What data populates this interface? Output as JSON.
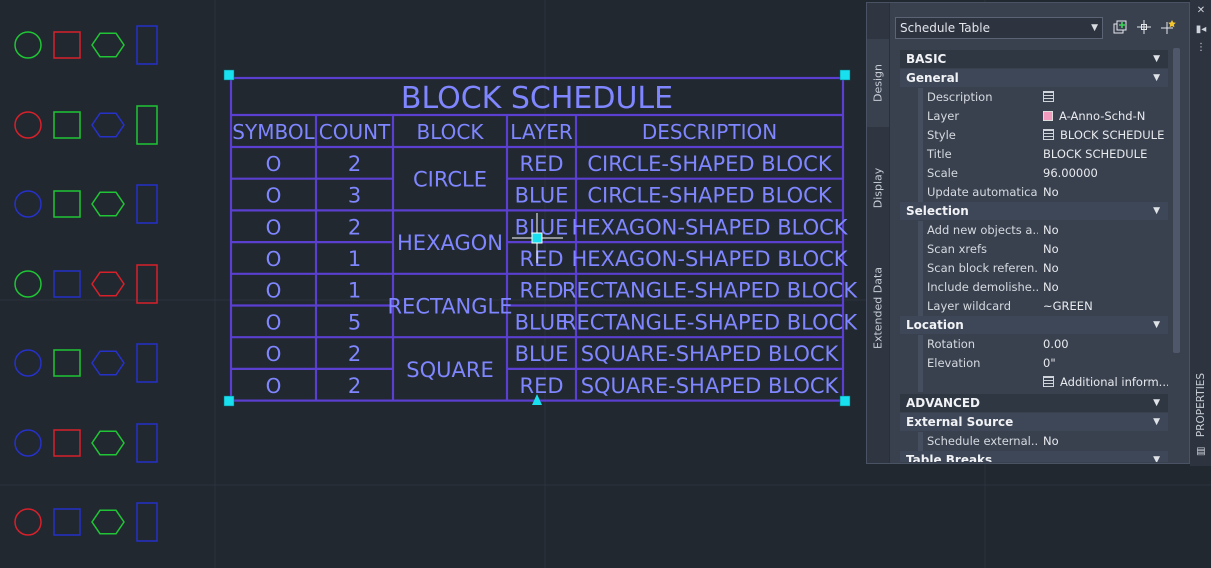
{
  "schedule": {
    "title": "BLOCK SCHEDULE",
    "headers": [
      "SYMBOL",
      "COUNT",
      "BLOCK",
      "LAYER",
      "DESCRIPTION"
    ],
    "symbol_glyph": "O",
    "rows": [
      {
        "count": "2",
        "layer": "RED",
        "description": "CIRCLE-SHAPED BLOCK"
      },
      {
        "count": "3",
        "layer": "BLUE",
        "description": "CIRCLE-SHAPED BLOCK"
      },
      {
        "count": "2",
        "layer": "BLUE",
        "description": "HEXAGON-SHAPED BLOCK"
      },
      {
        "count": "1",
        "layer": "RED",
        "description": "HEXAGON-SHAPED BLOCK"
      },
      {
        "count": "1",
        "layer": "RED",
        "description": "RECTANGLE-SHAPED BLOCK"
      },
      {
        "count": "5",
        "layer": "BLUE",
        "description": "RECTANGLE-SHAPED BLOCK"
      },
      {
        "count": "2",
        "layer": "BLUE",
        "description": "SQUARE-SHAPED BLOCK"
      },
      {
        "count": "2",
        "layer": "RED",
        "description": "SQUARE-SHAPED BLOCK"
      }
    ],
    "blocks": [
      "CIRCLE",
      "HEXAGON",
      "RECTANGLE",
      "SQUARE"
    ]
  },
  "shape_rows": [
    [
      {
        "shape": "circle",
        "color": "green"
      },
      {
        "shape": "square",
        "color": "red"
      },
      {
        "shape": "hexagon",
        "color": "green"
      },
      {
        "shape": "rectangle",
        "color": "blue"
      }
    ],
    [
      {
        "shape": "circle",
        "color": "red"
      },
      {
        "shape": "square",
        "color": "green"
      },
      {
        "shape": "hexagon",
        "color": "blue"
      },
      {
        "shape": "rectangle",
        "color": "green"
      }
    ],
    [
      {
        "shape": "circle",
        "color": "blue"
      },
      {
        "shape": "square",
        "color": "green"
      },
      {
        "shape": "hexagon",
        "color": "green"
      },
      {
        "shape": "rectangle",
        "color": "blue"
      }
    ],
    [
      {
        "shape": "circle",
        "color": "green"
      },
      {
        "shape": "square",
        "color": "blue"
      },
      {
        "shape": "hexagon",
        "color": "red"
      },
      {
        "shape": "rectangle",
        "color": "red"
      }
    ],
    [
      {
        "shape": "circle",
        "color": "blue"
      },
      {
        "shape": "square",
        "color": "green"
      },
      {
        "shape": "hexagon",
        "color": "blue"
      },
      {
        "shape": "rectangle",
        "color": "blue"
      }
    ],
    [
      {
        "shape": "circle",
        "color": "blue"
      },
      {
        "shape": "square",
        "color": "red"
      },
      {
        "shape": "hexagon",
        "color": "green"
      },
      {
        "shape": "rectangle",
        "color": "blue"
      }
    ],
    [
      {
        "shape": "circle",
        "color": "red"
      },
      {
        "shape": "square",
        "color": "blue"
      },
      {
        "shape": "hexagon",
        "color": "green"
      },
      {
        "shape": "rectangle",
        "color": "blue"
      }
    ]
  ],
  "colors": {
    "red": "#d8202a",
    "green": "#1fc535",
    "blue": "#2631c9",
    "table_line": "#5a3fd0",
    "table_text": "#7f86ff",
    "grip": "#19e0ee",
    "layer_swatch": "#f29bbf"
  },
  "palette": {
    "object_type": "Schedule Table",
    "tabs": [
      "Design",
      "Display",
      "Extended Data"
    ],
    "toolbar_icons": [
      "add-selection-icon",
      "select-objects-icon",
      "quick-select-icon"
    ],
    "sections": {
      "basic": "BASIC",
      "general": "General",
      "selection": "Selection",
      "location": "Location",
      "advanced": "ADVANCED",
      "external_source": "External Source",
      "table_breaks": "Table Breaks"
    },
    "general": [
      {
        "label": "Description",
        "value": "",
        "icon": "description-icon"
      },
      {
        "label": "Layer",
        "value": "A-Anno-Schd-N",
        "icon": "layer-swatch"
      },
      {
        "label": "Style",
        "value": "BLOCK SCHEDULE",
        "icon": "table-style-icon"
      },
      {
        "label": "Title",
        "value": "BLOCK SCHEDULE"
      },
      {
        "label": "Scale",
        "value": "96.00000"
      },
      {
        "label": "Update automatica...",
        "value": "No"
      }
    ],
    "selection": [
      {
        "label": "Add new objects a...",
        "value": "No"
      },
      {
        "label": "Scan xrefs",
        "value": "No"
      },
      {
        "label": "Scan block referen...",
        "value": "No"
      },
      {
        "label": "Include demolishe...",
        "value": "No"
      },
      {
        "label": "Layer wildcard",
        "value": "~GREEN"
      }
    ],
    "location": [
      {
        "label": "Rotation",
        "value": "0.00"
      },
      {
        "label": "Elevation",
        "value": "0\""
      },
      {
        "label": "",
        "value": "Additional inform...",
        "icon": "info-grid-icon"
      }
    ],
    "external_source": [
      {
        "label": "Schedule external...",
        "value": "No"
      }
    ]
  },
  "sidebar": {
    "label": "PROPERTIES",
    "icons": [
      "close-icon",
      "auto-hide-icon",
      "palette-options-icon",
      "properties-icon"
    ]
  }
}
